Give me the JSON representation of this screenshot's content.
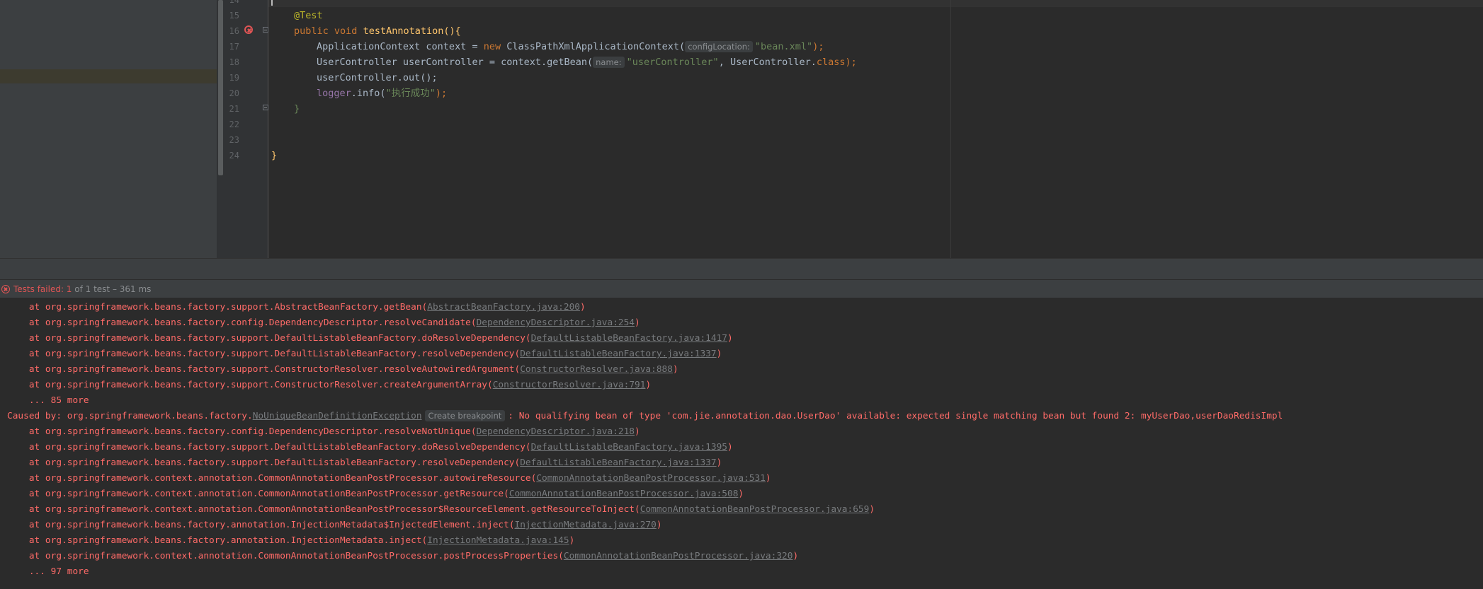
{
  "editor": {
    "line_numbers": [
      "14",
      "15",
      "16",
      "17",
      "18",
      "19",
      "20",
      "21",
      "22",
      "23",
      "24"
    ],
    "lines": {
      "l15_annotation": "@Test",
      "l16_kw1": "public",
      "l16_kw2": "void",
      "l16_name": "testAnnotation",
      "l16_rest": "(){",
      "l17_type": "ApplicationContext context = ",
      "l17_new": "new",
      "l17_class": " ClassPathXmlApplicationContext(",
      "l17_hint": "configLocation:",
      "l17_str": "\"bean.xml\"",
      "l17_end": ");",
      "l18_type": "UserController userController = context.getBean(",
      "l18_hint": "name:",
      "l18_str": "\"userController\"",
      "l18_mid": ", UserController.",
      "l18_class": "class",
      "l18_end": ");",
      "l19_code": "userController.out();",
      "l20_field": "logger",
      "l20_call": ".info(",
      "l20_str": "\"执行成功\"",
      "l20_end": ");",
      "l21_close": "}",
      "l24_close": "}"
    }
  },
  "test_bar": {
    "failed_label": "Tests failed: 1",
    "detail": " of 1 test – 361 ms"
  },
  "console": {
    "lines": [
      {
        "prefix": "    at org.springframework.beans.factory.support.AbstractBeanFactory.getBean(",
        "link": "AbstractBeanFactory.java:200",
        "suffix": ")"
      },
      {
        "prefix": "    at org.springframework.beans.factory.config.DependencyDescriptor.resolveCandidate(",
        "link": "DependencyDescriptor.java:254",
        "suffix": ")"
      },
      {
        "prefix": "    at org.springframework.beans.factory.support.DefaultListableBeanFactory.doResolveDependency(",
        "link": "DefaultListableBeanFactory.java:1417",
        "suffix": ")"
      },
      {
        "prefix": "    at org.springframework.beans.factory.support.DefaultListableBeanFactory.resolveDependency(",
        "link": "DefaultListableBeanFactory.java:1337",
        "suffix": ")"
      },
      {
        "prefix": "    at org.springframework.beans.factory.support.ConstructorResolver.resolveAutowiredArgument(",
        "link": "ConstructorResolver.java:888",
        "suffix": ")"
      },
      {
        "prefix": "    at org.springframework.beans.factory.support.ConstructorResolver.createArgumentArray(",
        "link": "ConstructorResolver.java:791",
        "suffix": ")"
      },
      {
        "prefix": "    ... 85 more",
        "link": "",
        "suffix": ""
      },
      {
        "prefix": "    at org.springframework.beans.factory.config.DependencyDescriptor.resolveNotUnique(",
        "link": "DependencyDescriptor.java:218",
        "suffix": ")"
      },
      {
        "prefix": "    at org.springframework.beans.factory.support.DefaultListableBeanFactory.doResolveDependency(",
        "link": "DefaultListableBeanFactory.java:1395",
        "suffix": ")"
      },
      {
        "prefix": "    at org.springframework.beans.factory.support.DefaultListableBeanFactory.resolveDependency(",
        "link": "DefaultListableBeanFactory.java:1337",
        "suffix": ")"
      },
      {
        "prefix": "    at org.springframework.context.annotation.CommonAnnotationBeanPostProcessor.autowireResource(",
        "link": "CommonAnnotationBeanPostProcessor.java:531",
        "suffix": ")"
      },
      {
        "prefix": "    at org.springframework.context.annotation.CommonAnnotationBeanPostProcessor.getResource(",
        "link": "CommonAnnotationBeanPostProcessor.java:508",
        "suffix": ")"
      },
      {
        "prefix": "    at org.springframework.context.annotation.CommonAnnotationBeanPostProcessor$ResourceElement.getResourceToInject(",
        "link": "CommonAnnotationBeanPostProcessor.java:659",
        "suffix": ")"
      },
      {
        "prefix": "    at org.springframework.beans.factory.annotation.InjectionMetadata$InjectedElement.inject(",
        "link": "InjectionMetadata.java:270",
        "suffix": ")"
      },
      {
        "prefix": "    at org.springframework.beans.factory.annotation.InjectionMetadata.inject(",
        "link": "InjectionMetadata.java:145",
        "suffix": ")"
      },
      {
        "prefix": "    at org.springframework.context.annotation.CommonAnnotationBeanPostProcessor.postProcessProperties(",
        "link": "CommonAnnotationBeanPostProcessor.java:320",
        "suffix": ")"
      },
      {
        "prefix": "    ... 97 more",
        "link": "",
        "suffix": ""
      }
    ],
    "caused_by": {
      "prefix": "Caused by: org.springframework.beans.factory.",
      "exception": "NoUniqueBeanDefinitionException",
      "breakpoint": "Create breakpoint",
      "message": ": No qualifying bean of type 'com.jie.annotation.dao.UserDao' available: expected single matching bean but found 2: myUserDao,userDaoRedisImpl"
    }
  },
  "colors": {
    "error": "#ff6b68",
    "keyword": "#cc7832",
    "string": "#6a8759",
    "method": "#ffc66d",
    "annotation": "#bbb529"
  }
}
